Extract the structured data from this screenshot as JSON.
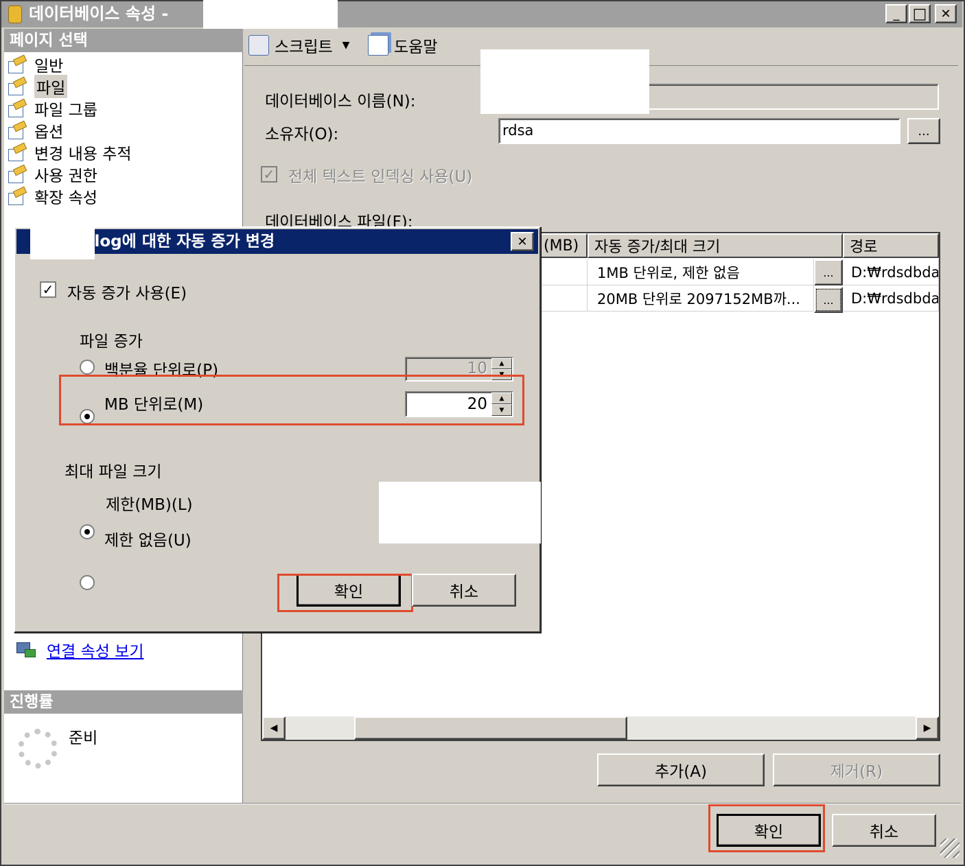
{
  "window": {
    "title": "데이터베이스 속성 -",
    "minimize": "_",
    "maximize": "□",
    "close": "✕"
  },
  "left_panel": {
    "header": "페이지 선택",
    "items": [
      {
        "label": "일반"
      },
      {
        "label": "파일"
      },
      {
        "label": "파일 그룹"
      },
      {
        "label": "옵션"
      },
      {
        "label": "변경 내용 추적"
      },
      {
        "label": "사용 권한"
      },
      {
        "label": "확장 속성"
      }
    ],
    "connection_link": "연결 속성 보기",
    "progress_header": "진행률",
    "progress_status": "준비"
  },
  "toolbar": {
    "script": "스크립트",
    "help": "도움말"
  },
  "form": {
    "db_name_label": "데이터베이스 이름(N):",
    "owner_label": "소유자(O):",
    "owner_value": "rdsa",
    "browse": "...",
    "fulltext_label": "전체 텍스트 인덱싱 사용(U)",
    "files_label": "데이터베이스 파일(F):"
  },
  "grid": {
    "columns": [
      "(MB)",
      "자동 증가/최대 크기",
      "경로"
    ],
    "rows": [
      {
        "growth": "1MB 단위로, 제한 없음",
        "path": "D:₩rdsdbda"
      },
      {
        "growth": "20MB 단위로 2097152MB까...",
        "path": "D:₩rdsdbda"
      }
    ],
    "cell_button": "..."
  },
  "buttons": {
    "add": "추가(A)",
    "remove": "제거(R)",
    "ok": "확인",
    "cancel": "취소"
  },
  "dialog": {
    "title": "_log에 대한 자동 증가 변경",
    "close": "✕",
    "autogrow_label": "자동 증가 사용(E)",
    "file_growth_label": "파일 증가",
    "percent_label": "백분율 단위로(P)",
    "percent_value": "10",
    "mb_label": "MB 단위로(M)",
    "mb_value": "20",
    "max_size_label": "최대 파일 크기",
    "limited_label": "제한(MB)(L)",
    "unlimited_label": "제한 없음(U)",
    "ok": "확인",
    "cancel": "취소"
  },
  "colors": {
    "highlight_red": "#e04a2e",
    "dialog_title_bg": "#0a246a",
    "link_blue": "#0000ee",
    "face_gray": "#d4d0c8"
  }
}
